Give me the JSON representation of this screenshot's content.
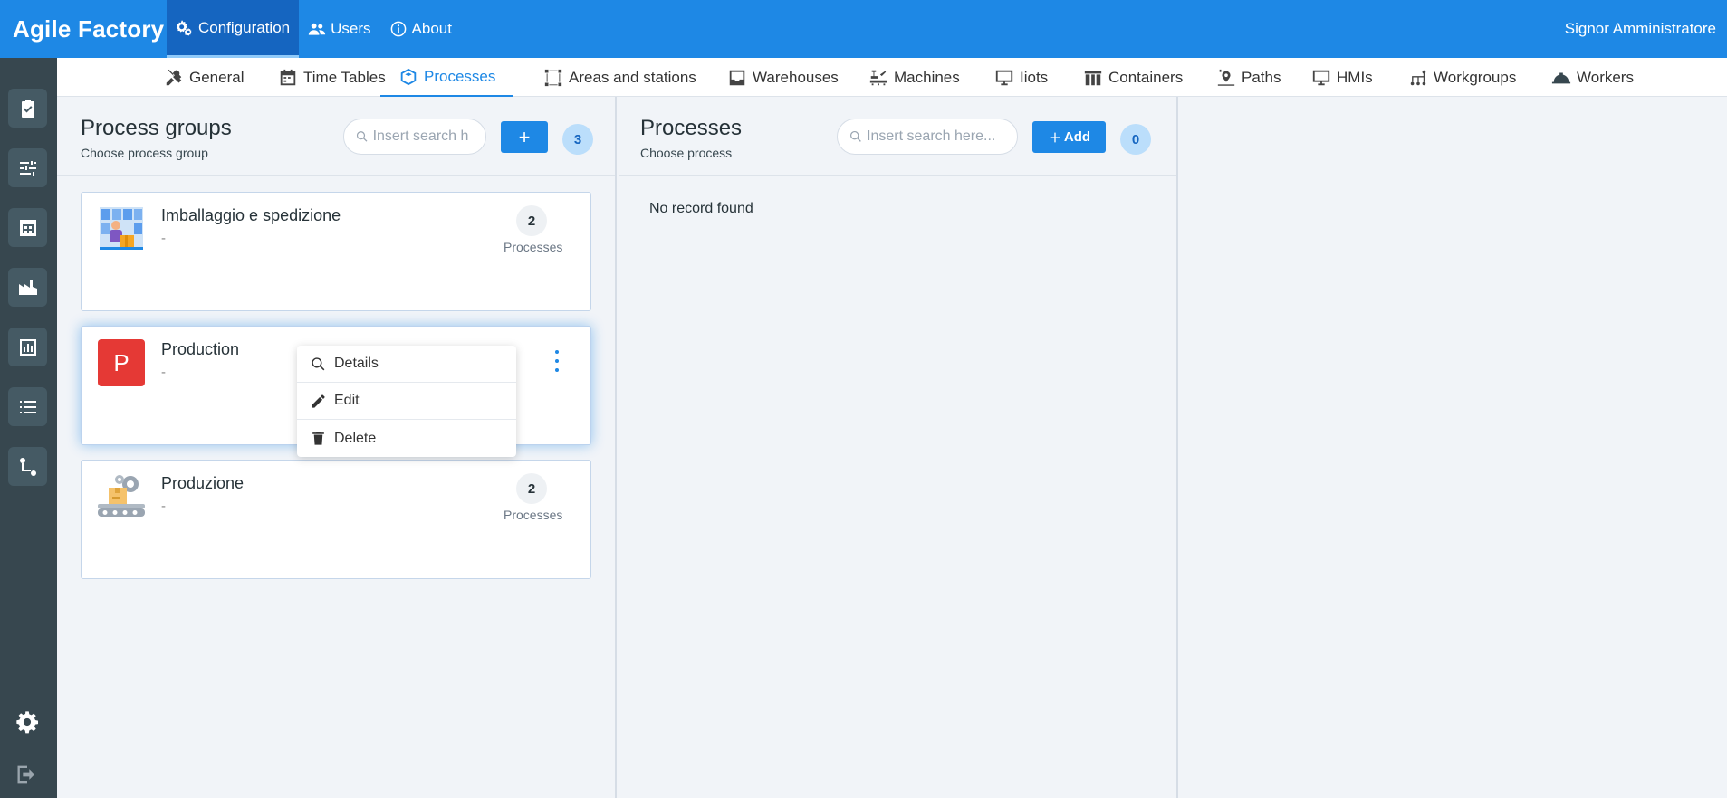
{
  "app": {
    "brand": "Agile Factory",
    "user_name": "Signor Amministratore"
  },
  "topnav": {
    "items": [
      {
        "label": "Configuration",
        "icon": "gears-icon",
        "active": true
      },
      {
        "label": "Users",
        "icon": "users-icon"
      },
      {
        "label": "About",
        "icon": "info-icon"
      }
    ]
  },
  "sidebar": {
    "items": [
      {
        "icon": "clipboard-check-icon"
      },
      {
        "icon": "sliders-icon"
      },
      {
        "icon": "warehouse-icon"
      },
      {
        "icon": "factory-icon"
      },
      {
        "icon": "bar-chart-icon"
      },
      {
        "icon": "list-icon"
      },
      {
        "icon": "route-icon"
      }
    ],
    "bottom": [
      {
        "icon": "gear-icon"
      },
      {
        "icon": "logout-icon"
      }
    ]
  },
  "subnav": {
    "tabs": [
      {
        "label": "General",
        "icon": "tools-icon"
      },
      {
        "label": "Time Tables",
        "icon": "calendar-icon"
      },
      {
        "label": "Processes",
        "icon": "process-icon",
        "active": true
      },
      {
        "label": "Areas and stations",
        "icon": "area-icon"
      },
      {
        "label": "Warehouses",
        "icon": "inbox-icon"
      },
      {
        "label": "Machines",
        "icon": "machine-icon"
      },
      {
        "label": "Iiots",
        "icon": "monitor-icon"
      },
      {
        "label": "Containers",
        "icon": "containers-icon"
      },
      {
        "label": "Paths",
        "icon": "paths-icon"
      },
      {
        "label": "HMIs",
        "icon": "monitor-icon"
      },
      {
        "label": "Workgroups",
        "icon": "workgroups-icon"
      },
      {
        "label": "Workers",
        "icon": "helmet-icon"
      }
    ]
  },
  "process_groups": {
    "title": "Process groups",
    "subtitle": "Choose process group",
    "search_placeholder": "Insert search h",
    "add_label": "+",
    "count": "3",
    "cards": [
      {
        "name": "Imballaggio e spedizione",
        "desc": "-",
        "count": "2",
        "count_label": "Processes",
        "thumb": "packing-illustration"
      },
      {
        "name": "Production",
        "desc": "-",
        "thumb_letter": "P"
      },
      {
        "name": "Produzione",
        "desc": "-",
        "count": "2",
        "count_label": "Processes",
        "thumb": "conveyor-illustration"
      }
    ],
    "context_menu": [
      {
        "label": "Details",
        "icon": "search-icon"
      },
      {
        "label": "Edit",
        "icon": "pencil-icon"
      },
      {
        "label": "Delete",
        "icon": "trash-icon"
      }
    ]
  },
  "processes": {
    "title": "Processes",
    "subtitle": "Choose process",
    "search_placeholder": "Insert search here...",
    "add_label": "Add",
    "count": "0",
    "empty_text": "No record found"
  },
  "colors": {
    "primary": "#1e88e5",
    "sidebar_bg": "#37474f",
    "card_letter_bg": "#e53935"
  }
}
